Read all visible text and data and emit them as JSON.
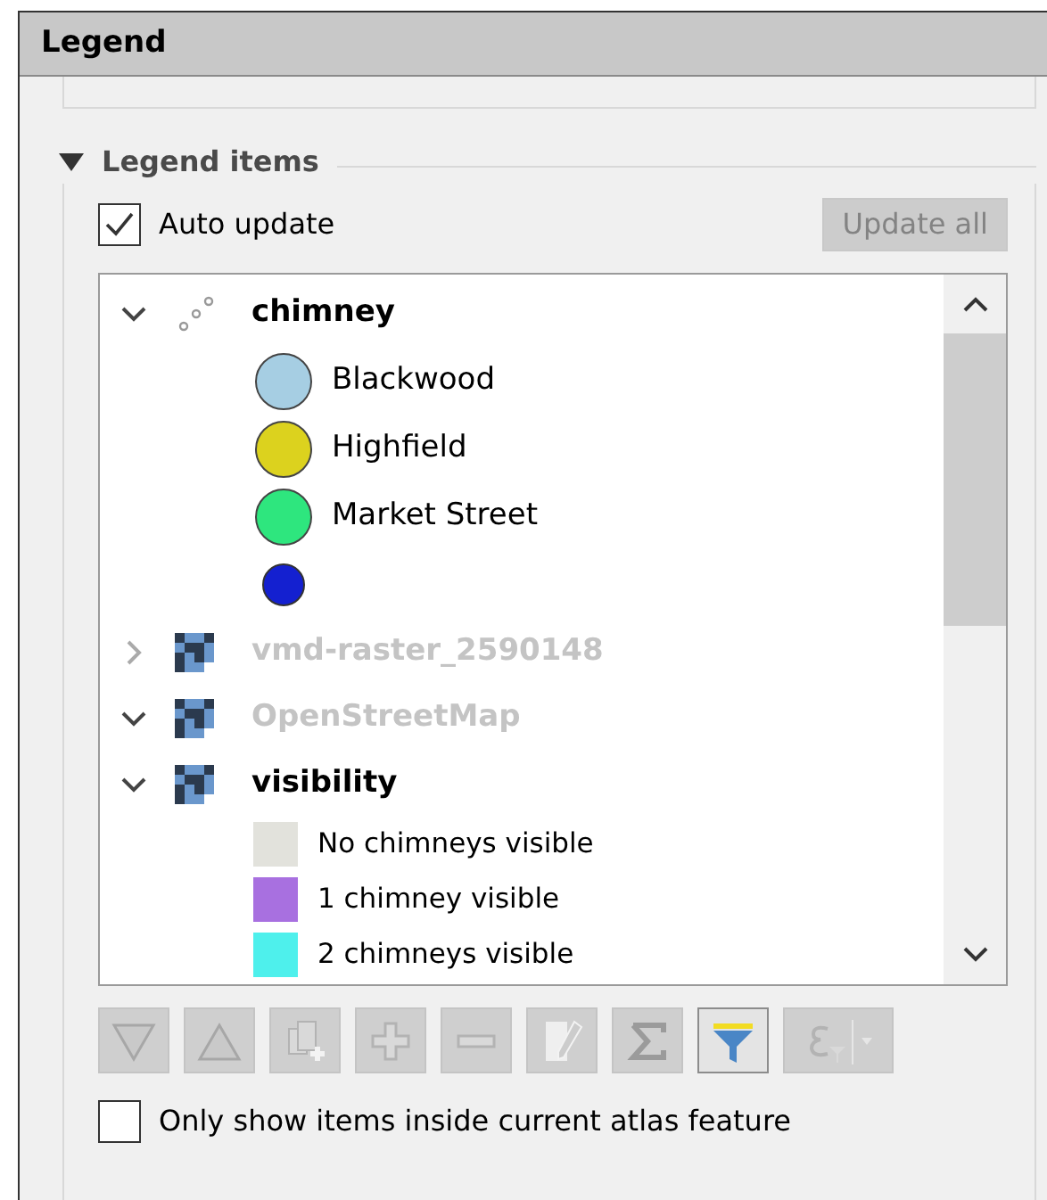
{
  "panel": {
    "title": "Legend"
  },
  "group": {
    "title": "Legend items",
    "expanded": true
  },
  "auto_update": {
    "label": "Auto update",
    "checked": true
  },
  "update_all": {
    "label": "Update all",
    "disabled": true
  },
  "tree": [
    {
      "label": "chimney",
      "kind": "points",
      "expanded": true,
      "disabled": false,
      "children": [
        {
          "label": "Blackwood",
          "kind": "circle",
          "color": "#a6cee3"
        },
        {
          "label": "Highfield",
          "kind": "circle",
          "color": "#dcd21e"
        },
        {
          "label": "Market Street",
          "kind": "circle",
          "color": "#2ee67e"
        },
        {
          "kind": "small-circle",
          "color": "#1420d0"
        }
      ]
    },
    {
      "label": "vmd-raster_2590148",
      "kind": "raster",
      "expanded": false,
      "disabled": true
    },
    {
      "label": "OpenStreetMap",
      "kind": "raster",
      "expanded": true,
      "disabled": true
    },
    {
      "label": "visibility",
      "kind": "raster",
      "expanded": true,
      "disabled": false,
      "children": [
        {
          "label": "No chimneys visible",
          "kind": "square",
          "color": "#e2e2dc"
        },
        {
          "label": "1 chimney visible",
          "kind": "square",
          "color": "#a870e0"
        },
        {
          "label": "2 chimneys visible",
          "kind": "square",
          "color": "#4ef0ec"
        }
      ]
    }
  ],
  "toolbar": [
    {
      "kind": "move-down",
      "disabled": true,
      "checked": false
    },
    {
      "kind": "move-up",
      "disabled": true,
      "checked": false
    },
    {
      "kind": "add-group",
      "disabled": true,
      "checked": false
    },
    {
      "kind": "add",
      "disabled": true,
      "checked": false
    },
    {
      "kind": "remove",
      "disabled": true,
      "checked": false
    },
    {
      "kind": "edit",
      "disabled": true,
      "checked": false
    },
    {
      "kind": "sum",
      "disabled": true,
      "checked": false
    },
    {
      "kind": "filter",
      "disabled": false,
      "checked": true
    },
    {
      "kind": "expression-filter",
      "disabled": true,
      "checked": false
    }
  ],
  "atlas_filter": {
    "label": "Only show items inside current atlas feature",
    "checked": false
  }
}
